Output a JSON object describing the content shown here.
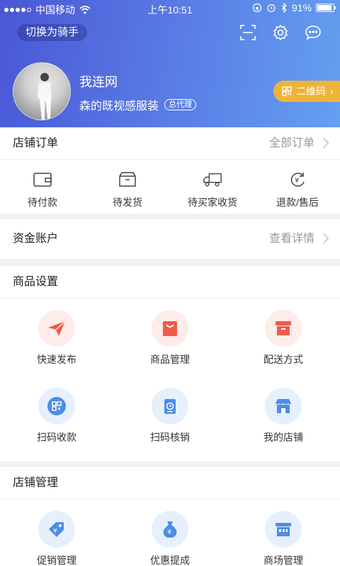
{
  "statusbar": {
    "carrier": "中国移动",
    "time": "上午10:51",
    "battery": "91%",
    "battery_level": 0.91
  },
  "header": {
    "switch_label": "切换为骑手",
    "shop_name": "我连网",
    "shop_sub": "森的既视感服装",
    "badge": "总代理",
    "qr_label": "二维码"
  },
  "orders": {
    "title": "店铺订单",
    "more": "全部订单",
    "items": [
      {
        "label": "待付款",
        "icon": "wallet-icon"
      },
      {
        "label": "待发货",
        "icon": "box-icon"
      },
      {
        "label": "待买家收货",
        "icon": "truck-icon"
      },
      {
        "label": "退款/售后",
        "icon": "refund-icon"
      }
    ]
  },
  "funds": {
    "title": "资金账户",
    "more": "查看详情"
  },
  "goods": {
    "title": "商品设置",
    "items": [
      {
        "label": "快速发布",
        "icon": "paper-plane-icon"
      },
      {
        "label": "商品管理",
        "icon": "shopping-bag-icon"
      },
      {
        "label": "配送方式",
        "icon": "delivery-box-icon"
      },
      {
        "label": "扫码收款",
        "icon": "qr-scan-icon"
      },
      {
        "label": "扫码核销",
        "icon": "scan-verify-icon"
      },
      {
        "label": "我的店铺",
        "icon": "storefront-icon"
      }
    ]
  },
  "store": {
    "title": "店铺管理",
    "items": [
      {
        "label": "促销管理",
        "icon": "promo-tag-icon"
      },
      {
        "label": "优惠提成",
        "icon": "money-bag-icon"
      },
      {
        "label": "商场管理",
        "icon": "mall-icon"
      }
    ]
  },
  "colors": {
    "header_start": "#4a57d6",
    "header_end": "#64a0f0",
    "qr_pill": "#f0b33a",
    "accent_red": "#ef5a4a",
    "accent_blue": "#4b8de8"
  }
}
